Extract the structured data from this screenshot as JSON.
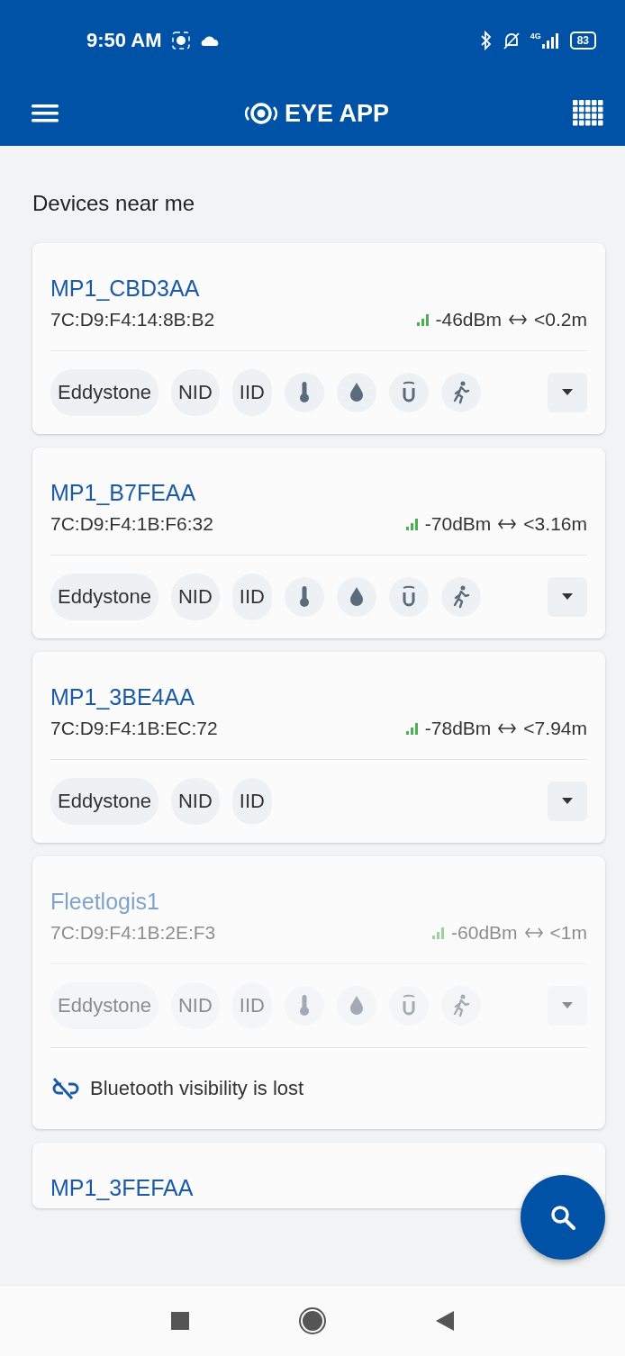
{
  "status_bar": {
    "time": "9:50 AM",
    "network": "4G",
    "battery": "83"
  },
  "app_bar": {
    "title": "EYE APP"
  },
  "section_title": "Devices near me",
  "devices": [
    {
      "name": "MP1_CBD3AA",
      "mac": "7C:D9:F4:14:8B:B2",
      "rssi": "-46dBm",
      "distance": "<0.2m",
      "lost": false,
      "tags": [
        {
          "kind": "text",
          "label": "Eddystone"
        },
        {
          "kind": "text",
          "label": "NID"
        },
        {
          "kind": "text",
          "label": "IID"
        },
        {
          "kind": "thermometer"
        },
        {
          "kind": "drop"
        },
        {
          "kind": "magnet"
        },
        {
          "kind": "runner"
        }
      ]
    },
    {
      "name": "MP1_B7FEAA",
      "mac": "7C:D9:F4:1B:F6:32",
      "rssi": "-70dBm",
      "distance": "<3.16m",
      "lost": false,
      "tags": [
        {
          "kind": "text",
          "label": "Eddystone"
        },
        {
          "kind": "text",
          "label": "NID"
        },
        {
          "kind": "text",
          "label": "IID"
        },
        {
          "kind": "thermometer"
        },
        {
          "kind": "drop"
        },
        {
          "kind": "magnet"
        },
        {
          "kind": "runner"
        }
      ]
    },
    {
      "name": "MP1_3BE4AA",
      "mac": "7C:D9:F4:1B:EC:72",
      "rssi": "-78dBm",
      "distance": "<7.94m",
      "lost": false,
      "tags": [
        {
          "kind": "text",
          "label": "Eddystone"
        },
        {
          "kind": "text",
          "label": "NID"
        },
        {
          "kind": "text",
          "label": "IID"
        }
      ]
    },
    {
      "name": "Fleetlogis1",
      "mac": "7C:D9:F4:1B:2E:F3",
      "rssi": "-60dBm",
      "distance": "<1m",
      "lost": true,
      "lost_message": "Bluetooth visibility is lost",
      "tags": [
        {
          "kind": "text",
          "label": "Eddystone"
        },
        {
          "kind": "text",
          "label": "NID"
        },
        {
          "kind": "text",
          "label": "IID"
        },
        {
          "kind": "thermometer"
        },
        {
          "kind": "drop"
        },
        {
          "kind": "magnet"
        },
        {
          "kind": "runner"
        }
      ]
    },
    {
      "name": "MP1_3FEFAA"
    }
  ]
}
